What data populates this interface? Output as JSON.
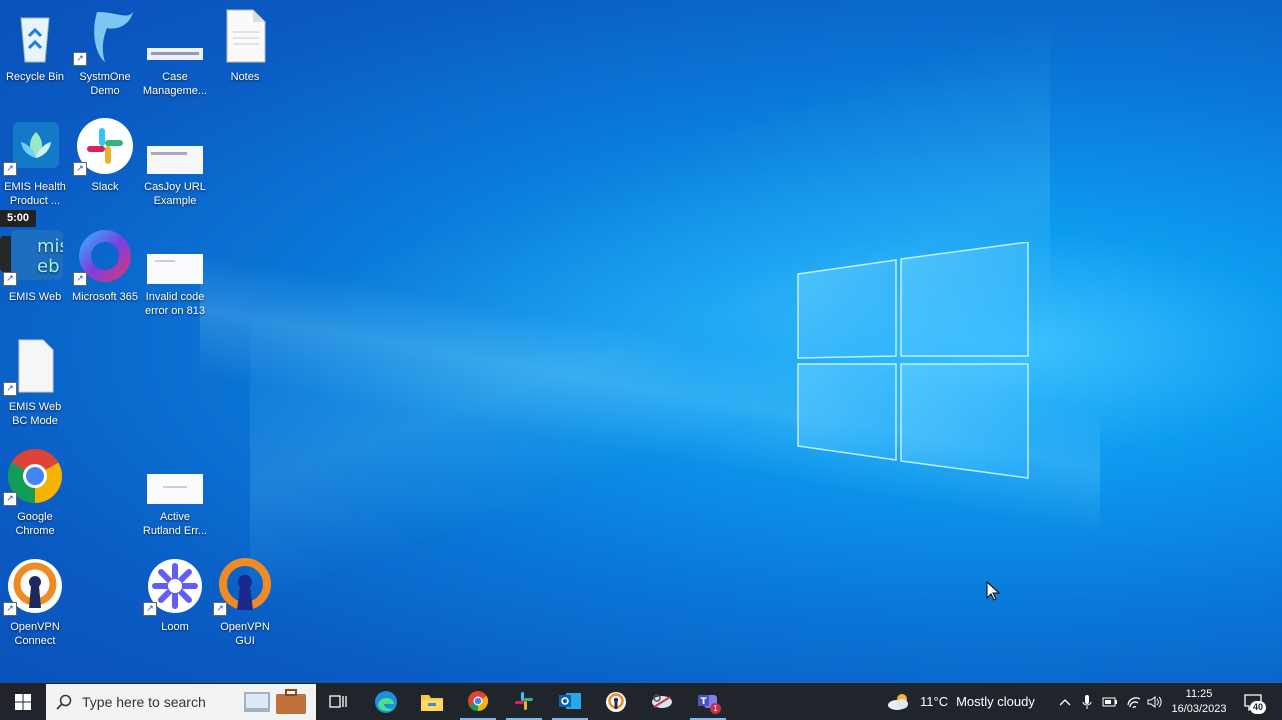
{
  "desktop": {
    "icons": [
      {
        "label": "Recycle Bin"
      },
      {
        "label": "SystmOne Demo"
      },
      {
        "label": "Case Manageme..."
      },
      {
        "label": "Notes"
      },
      {
        "label": "EMIS Health Product ..."
      },
      {
        "label": "Slack"
      },
      {
        "label": "CasJoy URL Example"
      },
      {
        "label": "EMIS Web"
      },
      {
        "label": "Microsoft 365"
      },
      {
        "label": "Invalid code error on 813"
      },
      {
        "label": "EMIS Web BC Mode"
      },
      {
        "label": "Google Chrome"
      },
      {
        "label": "Active Rutland Err..."
      },
      {
        "label": "OpenVPN Connect"
      },
      {
        "label": "Loom"
      },
      {
        "label": "OpenVPN GUI"
      }
    ],
    "recording_timer": "5:00"
  },
  "taskbar": {
    "search_placeholder": "Type here to search",
    "weather": {
      "temp": "11°C",
      "condition": "Mostly cloudy"
    },
    "clock": {
      "time": "11:25",
      "date": "16/03/2023"
    },
    "notification_count": "40",
    "apps": [
      "task-view",
      "edge",
      "file-explorer",
      "chrome",
      "slack",
      "outlook",
      "openvpn",
      "snipping",
      "teams"
    ],
    "teams_badge": "1"
  },
  "colors": {
    "accent": "#0a78d8",
    "taskbar": "#20252b"
  }
}
